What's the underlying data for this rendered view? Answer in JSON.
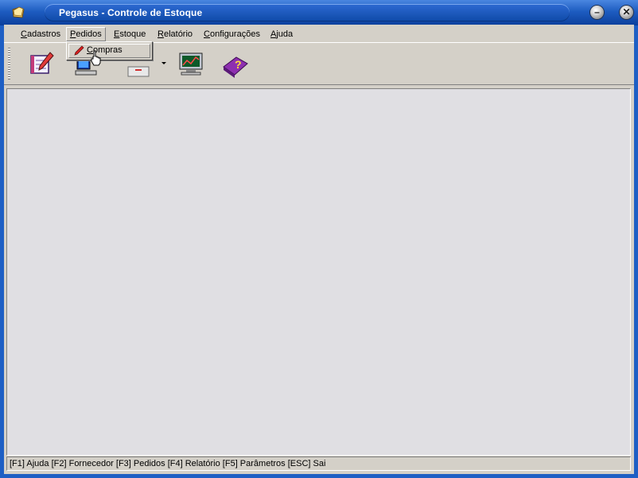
{
  "window": {
    "title": "Pegasus - Controle de Estoque"
  },
  "menu": {
    "items": [
      {
        "label": "Cadastros",
        "mnemonic": "C",
        "rest": "adastros"
      },
      {
        "label": "Pedidos",
        "mnemonic": "P",
        "rest": "edidos"
      },
      {
        "label": "Estoque",
        "mnemonic": "E",
        "rest": "stoque"
      },
      {
        "label": "Relatório",
        "mnemonic": "R",
        "rest": "elatório"
      },
      {
        "label": "Configurações",
        "mnemonic": "C",
        "rest": "onfigurações"
      },
      {
        "label": "Ajuda",
        "mnemonic": "A",
        "rest": "juda"
      }
    ],
    "open_menu": "Pedidos",
    "popup": {
      "items": [
        {
          "label": "Compras",
          "mnemonic": "C",
          "rest": "ompras",
          "icon": "pencil-icon"
        }
      ]
    }
  },
  "toolbar": {
    "tools": [
      {
        "name": "cadastros-tool",
        "icon": "notebook-pencil-icon"
      },
      {
        "name": "pedidos-tool",
        "icon": "computer-keyboard-icon"
      },
      {
        "name": "estoque-tool",
        "icon": "drawer-icon"
      },
      {
        "name": "relatorio-tool",
        "icon": "monitor-chart-icon"
      },
      {
        "name": "ajuda-tool",
        "icon": "help-book-icon"
      }
    ]
  },
  "status": {
    "text": "[F1] Ajuda [F2] Fornecedor [F3] Pedidos [F4] Relatório [F5] Parâmetros [ESC] Sai"
  },
  "colors": {
    "title_bar": "#1d5cc0",
    "menu_bg": "#d4d0c8",
    "workspace": "#e0dfe3"
  }
}
